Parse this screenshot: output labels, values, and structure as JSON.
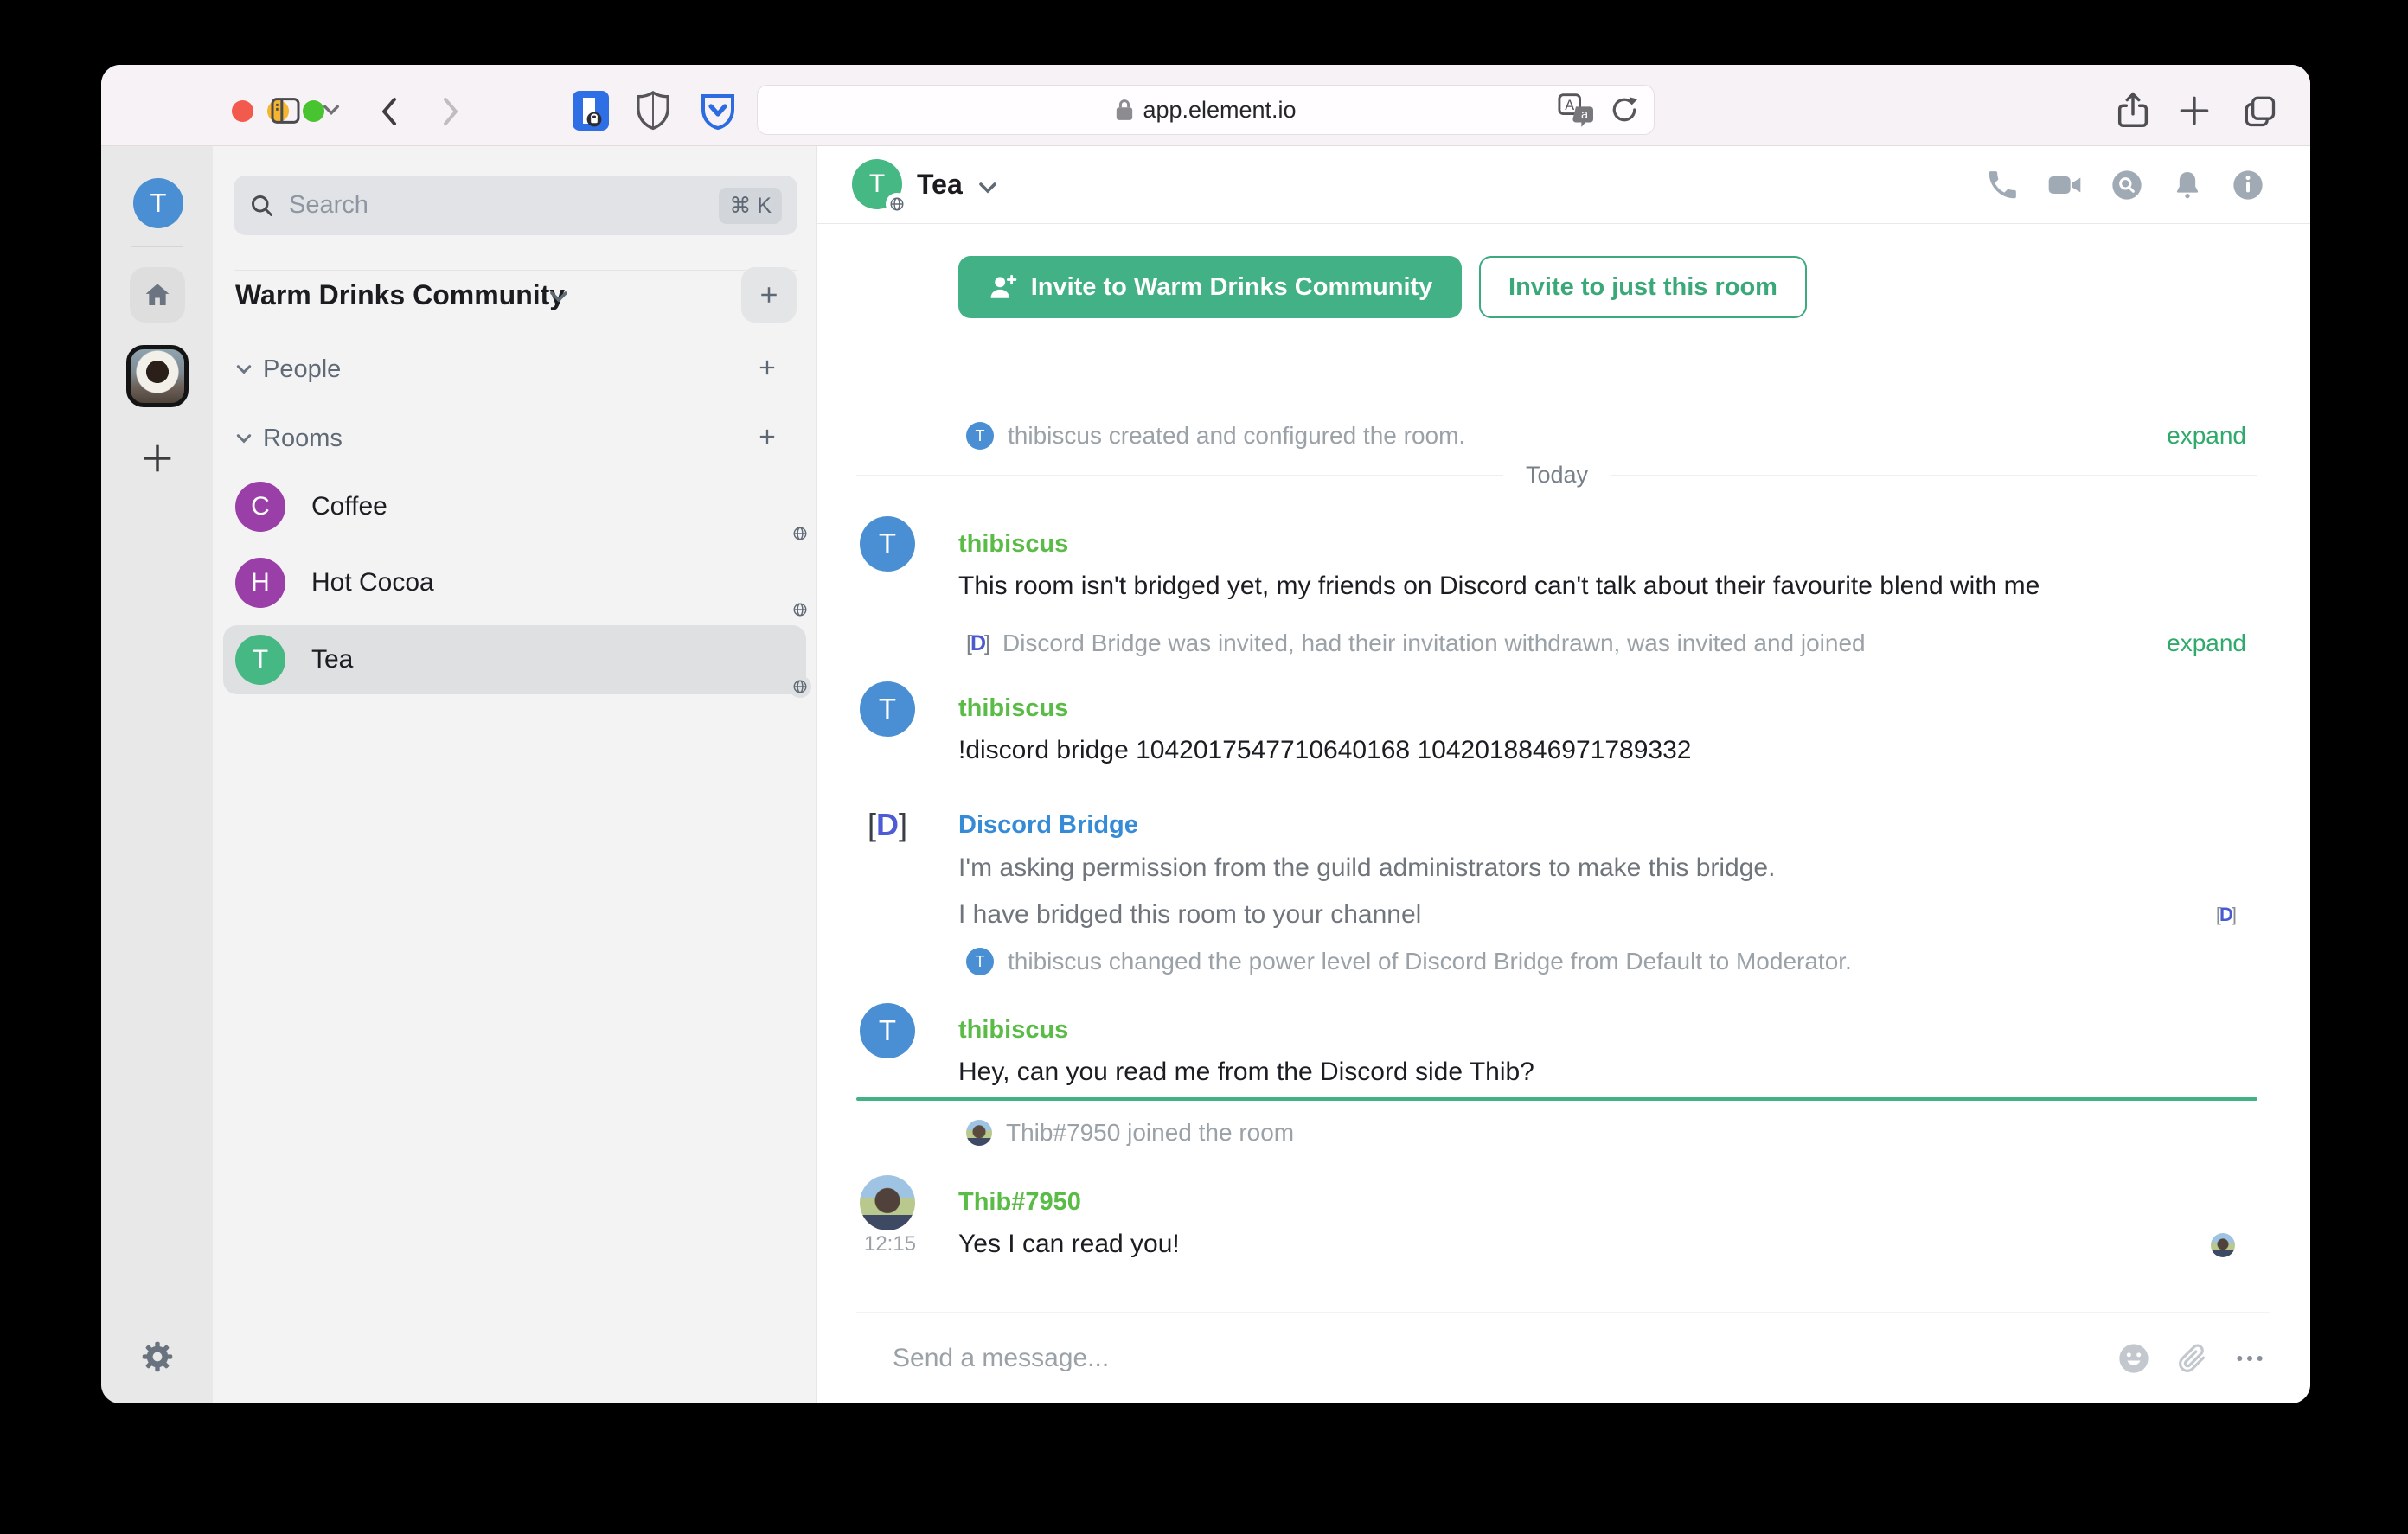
{
  "colors": {
    "accent_green": "#42b185",
    "link_green": "#2fa96c",
    "sender_green": "#5abb46",
    "bridge_name_blue": "#368bd6",
    "avatar_blue": "#4a8fd3",
    "avatar_purple": "#9b3fa8",
    "avatar_green": "#45b884",
    "unread_marker": "#42b185"
  },
  "browser": {
    "url": "app.element.io"
  },
  "rail": {
    "user_initial": "T"
  },
  "panel": {
    "search": {
      "placeholder": "Search",
      "shortcut": "⌘ K"
    },
    "community_name": "Warm Drinks Community",
    "sections": {
      "people": "People",
      "rooms": "Rooms"
    },
    "rooms": [
      {
        "name": "Coffee",
        "initial": "C"
      },
      {
        "name": "Hot Cocoa",
        "initial": "H"
      },
      {
        "name": "Tea",
        "initial": "T"
      }
    ]
  },
  "header": {
    "room_name": "Tea"
  },
  "invites": {
    "primary": "Invite to Warm Drinks Community",
    "secondary": "Invite to just this room"
  },
  "timeline": {
    "created": {
      "avatar_initial": "T",
      "text": "thibiscus created and configured the room.",
      "action": "expand"
    },
    "day_separator": "Today",
    "msg_not_bridged": {
      "sender": "thibiscus",
      "avatar_initial": "T",
      "body": "This room isn't bridged yet, my friends on Discord can't talk about their favourite blend with me"
    },
    "bridge_membership": {
      "text": "Discord Bridge was invited, had their invitation withdrawn, was invited and joined",
      "action": "expand"
    },
    "msg_command": {
      "sender": "thibiscus",
      "avatar_initial": "T",
      "body": "!discord bridge 1042017547710640168 1042018846971789332"
    },
    "msg_bridge": {
      "sender": "Discord Bridge",
      "line1": "I'm asking permission from the guild administrators to make this bridge.",
      "line2": "I have bridged this room to your channel"
    },
    "power_level": {
      "avatar_initial": "T",
      "text": "thibiscus changed the power level of Discord Bridge from Default to Moderator."
    },
    "msg_hey": {
      "sender": "thibiscus",
      "avatar_initial": "T",
      "body": "Hey, can you read me from the Discord side Thib?"
    },
    "joined": {
      "text": "Thib#7950 joined the room"
    },
    "msg_reply": {
      "sender": "Thib#7950",
      "time": "12:15",
      "body": "Yes I can read you!"
    }
  },
  "composer": {
    "placeholder": "Send a message..."
  }
}
